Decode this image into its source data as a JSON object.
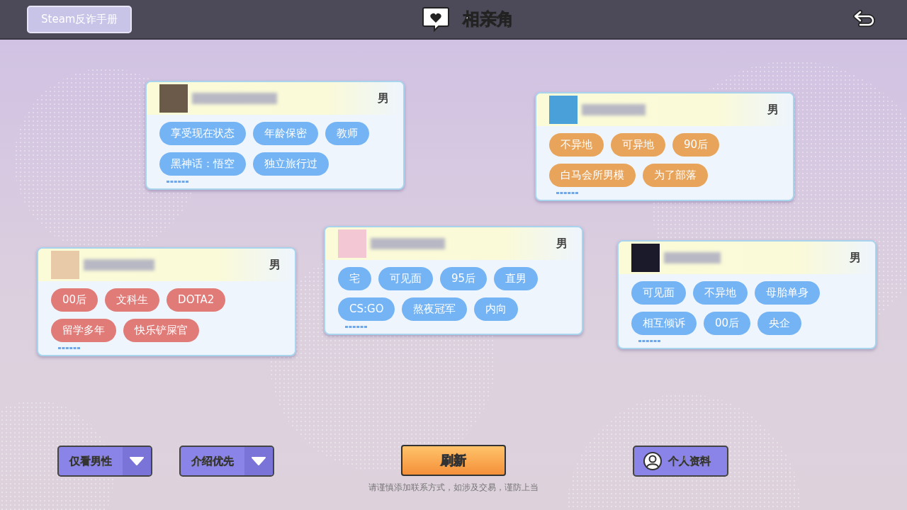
{
  "header": {
    "guide_button": "Steam反诈手册",
    "title": "相亲角"
  },
  "cards": [
    {
      "gender": "男",
      "color": "#74b4f5",
      "tags": [
        "享受现在状态",
        "年龄保密",
        "教师",
        "黑神话：悟空",
        "独立旅行过"
      ]
    },
    {
      "gender": "男",
      "color": "#e8a45a",
      "tags": [
        "不异地",
        "可异地",
        "90后",
        "白马会所男模",
        "为了部落"
      ]
    },
    {
      "gender": "男",
      "color": "#e07b78",
      "tags": [
        "00后",
        "文科生",
        "DOTA2",
        "留学多年",
        "快乐铲屎官"
      ]
    },
    {
      "gender": "男",
      "color": "#74b4f5",
      "tags": [
        "宅",
        "可见面",
        "95后",
        "直男",
        "CS:GO",
        "熬夜冠军",
        "内向"
      ]
    },
    {
      "gender": "男",
      "color": "#74b4f5",
      "tags": [
        "可见面",
        "不异地",
        "母胎单身",
        "相互倾诉",
        "00后",
        "央企"
      ]
    }
  ],
  "footer": {
    "filters": [
      "仅看男性",
      "介绍优先"
    ],
    "refresh": "刷新",
    "notice": "请谨慎添加联系方式，如涉及交易，谨防上当",
    "profile": "个人资料"
  }
}
